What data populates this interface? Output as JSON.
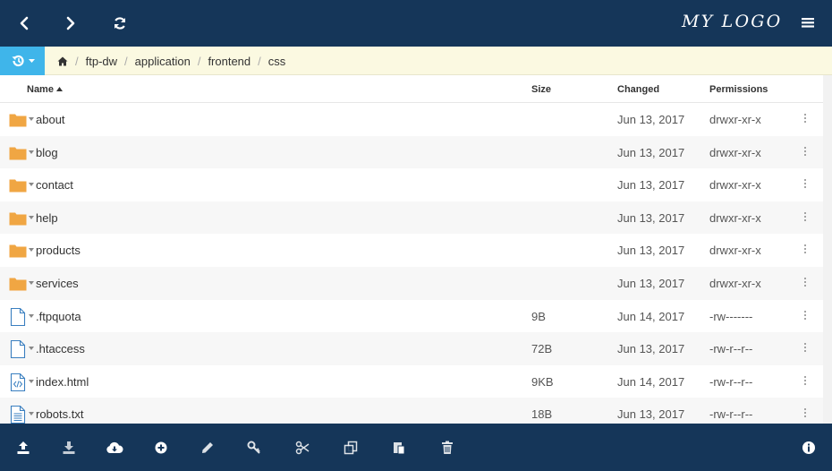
{
  "topbar": {
    "logo": "MY LOGO",
    "icons": [
      "chevron-left-icon",
      "chevron-right-icon",
      "refresh-icon",
      "hamburger-menu-icon"
    ]
  },
  "pathbar": {
    "history_icon": "history-icon",
    "home_icon": "home-icon",
    "crumbs": [
      "ftp-dw",
      "application",
      "frontend",
      "css"
    ]
  },
  "columns": {
    "name": "Name",
    "size": "Size",
    "changed": "Changed",
    "permissions": "Permissions"
  },
  "files": [
    {
      "name": "about",
      "size": "",
      "changed": "Jun 13, 2017",
      "permissions": "drwxr-xr-x",
      "type": "folder"
    },
    {
      "name": "blog",
      "size": "",
      "changed": "Jun 13, 2017",
      "permissions": "drwxr-xr-x",
      "type": "folder"
    },
    {
      "name": "contact",
      "size": "",
      "changed": "Jun 13, 2017",
      "permissions": "drwxr-xr-x",
      "type": "folder"
    },
    {
      "name": "help",
      "size": "",
      "changed": "Jun 13, 2017",
      "permissions": "drwxr-xr-x",
      "type": "folder"
    },
    {
      "name": "products",
      "size": "",
      "changed": "Jun 13, 2017",
      "permissions": "drwxr-xr-x",
      "type": "folder"
    },
    {
      "name": "services",
      "size": "",
      "changed": "Jun 13, 2017",
      "permissions": "drwxr-xr-x",
      "type": "folder"
    },
    {
      "name": ".ftpquota",
      "size": "9B",
      "changed": "Jun 14, 2017",
      "permissions": "-rw-------",
      "type": "file"
    },
    {
      "name": ".htaccess",
      "size": "72B",
      "changed": "Jun 13, 2017",
      "permissions": "-rw-r--r--",
      "type": "file"
    },
    {
      "name": "index.html",
      "size": "9KB",
      "changed": "Jun 14, 2017",
      "permissions": "-rw-r--r--",
      "type": "code"
    },
    {
      "name": "robots.txt",
      "size": "18B",
      "changed": "Jun 13, 2017",
      "permissions": "-rw-r--r--",
      "type": "text"
    }
  ],
  "toolbar": {
    "icons": [
      "upload-icon",
      "download-icon",
      "cloud-download-icon",
      "add-icon",
      "edit-icon",
      "key-icon",
      "cut-icon",
      "copy-icon",
      "paste-icon",
      "delete-icon",
      "info-icon"
    ]
  },
  "colors": {
    "navy": "#153659",
    "accent": "#3fb5ea",
    "folder": "#f0a643",
    "file": "#3a7fc0",
    "pathbar_bg": "#fbf9e1"
  }
}
